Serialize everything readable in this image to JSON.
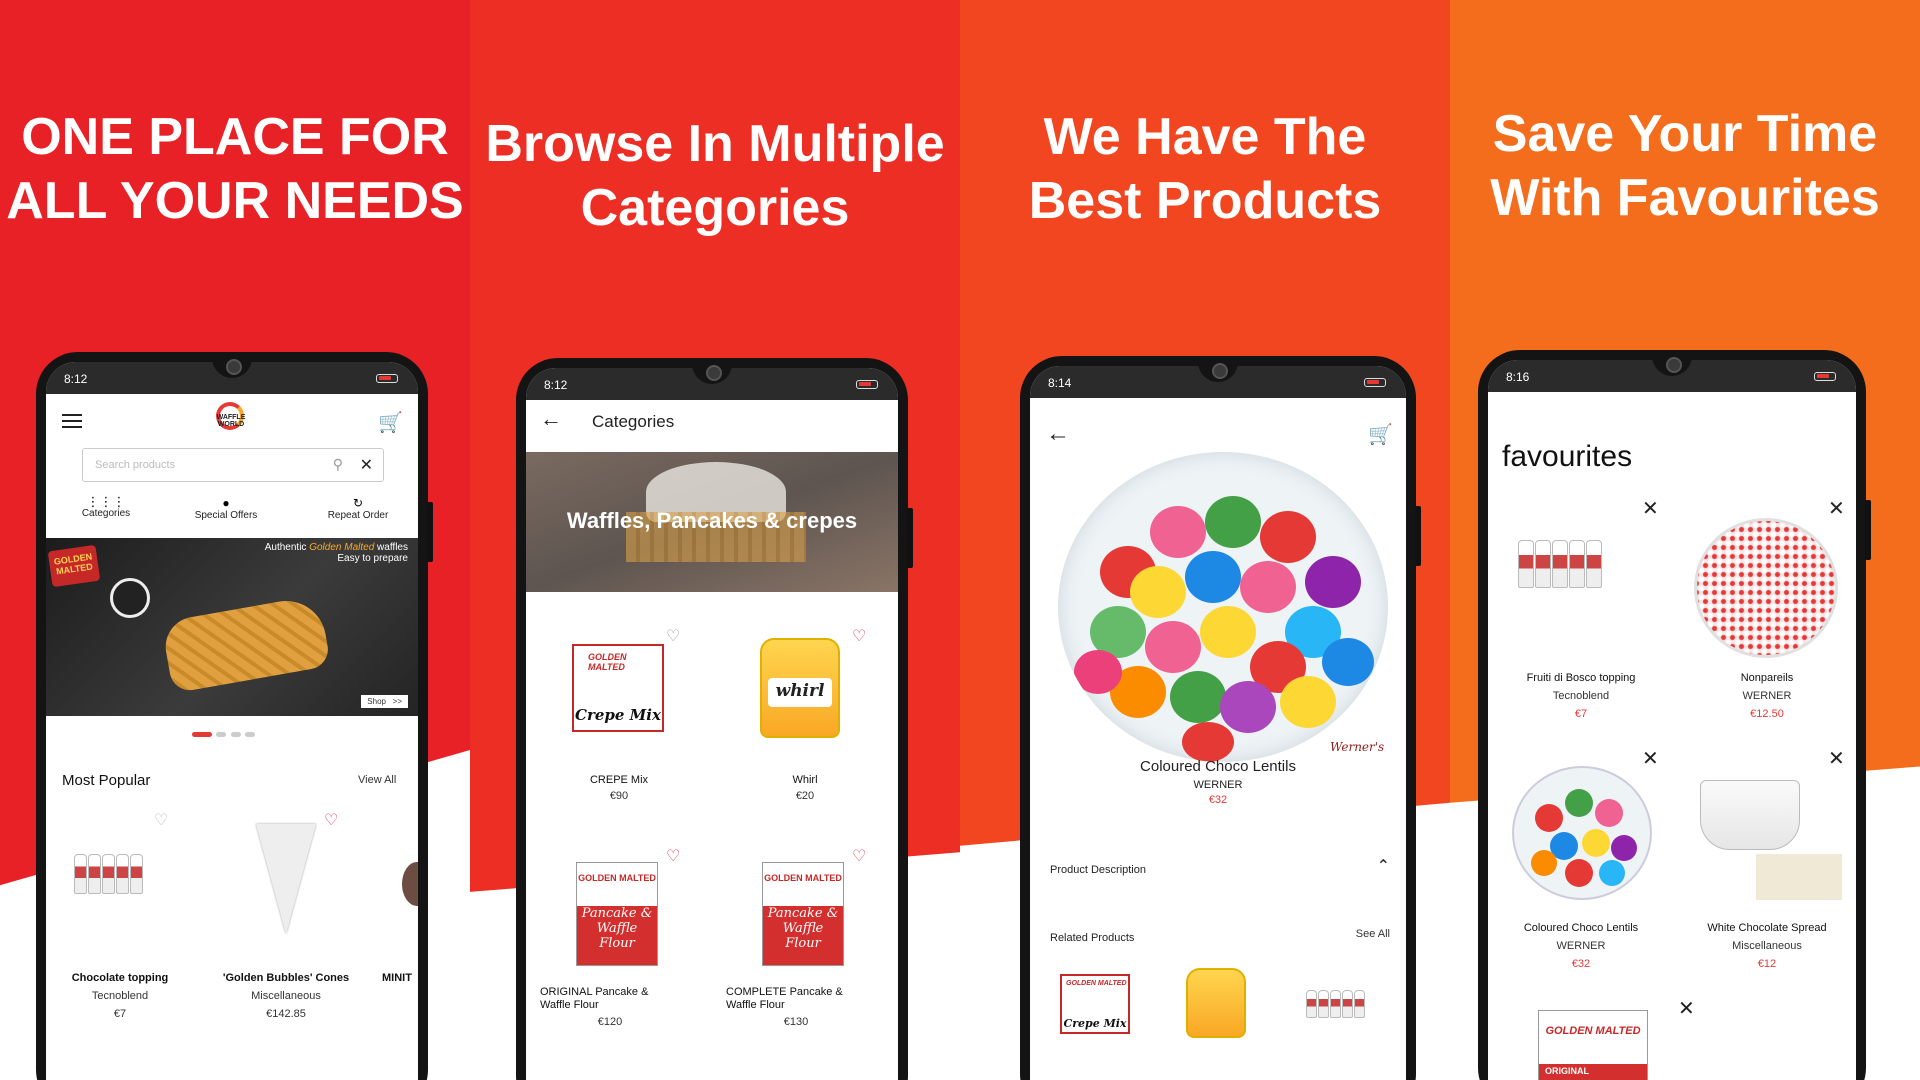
{
  "colors": {
    "panel1": "#e82127",
    "panel2": "#ec2e24",
    "panel3": "#f1461f",
    "panel4": "#f46d1d",
    "accent": "#e53935",
    "heart": "#e53950"
  },
  "panels": [
    {
      "headline": [
        "ONE PLACE FOR",
        "ALL YOUR NEEDS"
      ]
    },
    {
      "headline": [
        "Browse In Multiple",
        "Categories"
      ]
    },
    {
      "headline": [
        "We Have The",
        "Best Products"
      ]
    },
    {
      "headline": [
        "Save Your Time",
        "With Favourites"
      ]
    }
  ],
  "screen1": {
    "time": "8:12",
    "logo_text": "WAFFLE WORLD",
    "search_placeholder": "Search products",
    "quick_links": [
      "Categories",
      "Special Offers",
      "Repeat Order"
    ],
    "banner": {
      "line1_pre": "Authentic ",
      "line1_brand": "Golden Malted",
      "line1_post": " waffles",
      "line2": "Easy to prepare",
      "shop": "Shop",
      "badge": "GOLDEN MALTED"
    },
    "section_title": "Most Popular",
    "view_all": "View All",
    "products": [
      {
        "name": "Chocolate topping",
        "brand": "Tecnoblend",
        "price": "€7"
      },
      {
        "name": "'Golden Bubbles' Cones",
        "brand": "Miscellaneous",
        "price": "€142.85"
      },
      {
        "name": "MINIT"
      }
    ]
  },
  "screen2": {
    "time": "8:12",
    "title": "Categories",
    "hero": "Waffles, Pancakes & crepes",
    "products": [
      {
        "name": "CREPE Mix",
        "price": "€90",
        "label": "Crepe Mix",
        "badge": "GOLDEN MALTED"
      },
      {
        "name": "Whirl",
        "price": "€20",
        "label": "whirl"
      },
      {
        "name": "ORIGINAL Pancake & Waffle Flour",
        "price": "€120",
        "label": "Pancake & Waffle Flour",
        "badge": "GOLDEN MALTED"
      },
      {
        "name": "COMPLETE Pancake & Waffle Flour",
        "price": "€130",
        "label": "Pancake & Waffle Flour",
        "badge": "GOLDEN MALTED"
      }
    ]
  },
  "screen3": {
    "time": "8:14",
    "product": {
      "name": "Coloured Choco Lentils",
      "brand": "WERNER",
      "price": "€32",
      "watermark": "Werner's"
    },
    "description_label": "Product Description",
    "related_label": "Related Products",
    "see_all": "See All",
    "related_labels": [
      "Crepe Mix",
      "GOLDEN MALTED"
    ]
  },
  "screen4": {
    "time": "8:16",
    "title": "favourites",
    "items": [
      {
        "name": "Fruiti di Bosco topping",
        "brand": "Tecnoblend",
        "price": "€7"
      },
      {
        "name": "Nonpareils",
        "brand": "WERNER",
        "price": "€12.50"
      },
      {
        "name": "Coloured Choco Lentils",
        "brand": "WERNER",
        "price": "€32"
      },
      {
        "name": "White Chocolate Spread",
        "brand": "Miscellaneous",
        "price": "€12"
      }
    ],
    "fifth_badge": "GOLDEN MALTED",
    "fifth_label": "ORIGINAL"
  }
}
